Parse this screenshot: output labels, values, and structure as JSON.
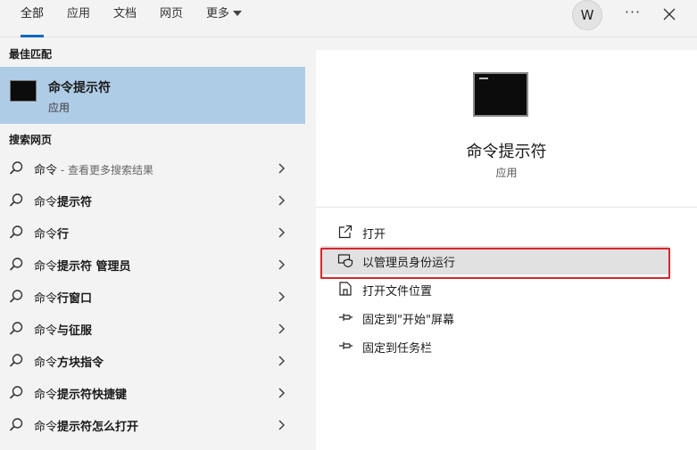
{
  "tabs": [
    {
      "label": "全部"
    },
    {
      "label": "应用"
    },
    {
      "label": "文档"
    },
    {
      "label": "网页"
    },
    {
      "label": "更多"
    }
  ],
  "account": {
    "avatar_letter": "W"
  },
  "toolbar": {
    "more_label": "···"
  },
  "sections": {
    "best_match": "最佳匹配",
    "search_web": "搜索网页"
  },
  "best_match": {
    "title": "命令提示符",
    "subtitle": "应用"
  },
  "web_results": [
    {
      "query": "命令",
      "suffix": " - 查看更多搜索结果",
      "bold_tail": ""
    },
    {
      "query": "命令",
      "suffix": "",
      "bold_tail": "提示符"
    },
    {
      "query": "命令",
      "suffix": "",
      "bold_tail": "行"
    },
    {
      "query": "命令",
      "suffix": "",
      "bold_tail": "提示符 管理员"
    },
    {
      "query": "命令",
      "suffix": "",
      "bold_tail": "行窗口"
    },
    {
      "query": "命令",
      "suffix": "",
      "bold_tail": "与征服"
    },
    {
      "query": "命令",
      "suffix": "",
      "bold_tail": "方块指令"
    },
    {
      "query": "命令",
      "suffix": "",
      "bold_tail": "提示符快捷键"
    },
    {
      "query": "命令",
      "suffix": "",
      "bold_tail": "提示符怎么打开"
    }
  ],
  "detail": {
    "title": "命令提示符",
    "subtitle": "应用"
  },
  "actions": [
    {
      "label": "打开",
      "icon": "open-icon"
    },
    {
      "label": "以管理员身份运行",
      "icon": "shield-run-icon"
    },
    {
      "label": "打开文件位置",
      "icon": "file-location-icon"
    },
    {
      "label": "固定到\"开始\"屏幕",
      "icon": "pin-icon"
    },
    {
      "label": "固定到任务栏",
      "icon": "pin-icon"
    }
  ],
  "colors": {
    "accent": "#0067c0",
    "selected_bg": "#aecce6",
    "highlight_border": "#d9262a"
  }
}
